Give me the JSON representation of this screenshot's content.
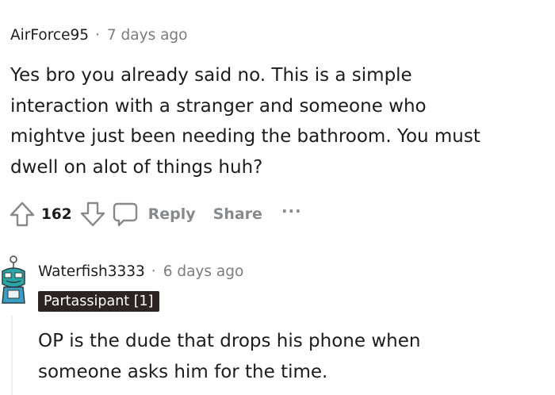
{
  "comment1": {
    "author": "AirForce95",
    "separator": "·",
    "timestamp": "7 days ago",
    "body": "Yes bro you already said no. This is a simple\ninteraction with a stranger and someone who\nmightve just been needing the bathroom. You must\ndwell on alot of things huh?",
    "score": "162",
    "reply_label": "Reply",
    "share_label": "Share",
    "more_label": "···",
    "icons": {
      "upvote": "upvote-arrow-icon",
      "downvote": "downvote-arrow-icon",
      "reply": "speech-bubble-icon"
    }
  },
  "comment2": {
    "author": "Waterfish3333",
    "separator": "·",
    "timestamp": "6 days ago",
    "flair": "Partassipant [1]",
    "body": "OP is the dude that drops his phone when\nsomeone asks him for the time.",
    "avatar_icon": "snoo-avatar-icon"
  },
  "colors": {
    "text": "#1c1c1c",
    "meta": "#7c7c7c",
    "action": "#878a8c",
    "flair_bg": "#2b2422",
    "flair_text": "#ffffff",
    "avatar_teal": "#2aa6a6"
  }
}
